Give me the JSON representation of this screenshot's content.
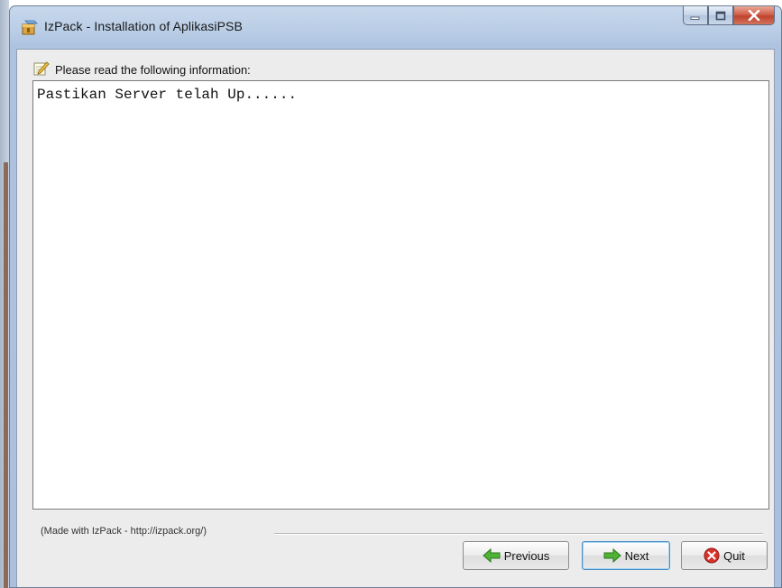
{
  "window": {
    "title": "IzPack - Installation of AplikasiPSB",
    "controls": {
      "minimize_icon": "minimize-icon",
      "maximize_icon": "maximize-icon",
      "close_icon": "close-icon"
    }
  },
  "panel": {
    "info_label": "Please read the following information:",
    "info_icon": "edit-note-icon",
    "text_content": "Pastikan Server telah Up......"
  },
  "footer": {
    "made_with": "(Made with IzPack - http://izpack.org/)"
  },
  "buttons": {
    "previous": "Previous",
    "next": "Next",
    "quit": "Quit"
  },
  "colors": {
    "title_bar": "#b9cde6",
    "close_button": "#c9503a",
    "arrow_green": "#3a9a2a",
    "quit_red": "#c8261e"
  }
}
